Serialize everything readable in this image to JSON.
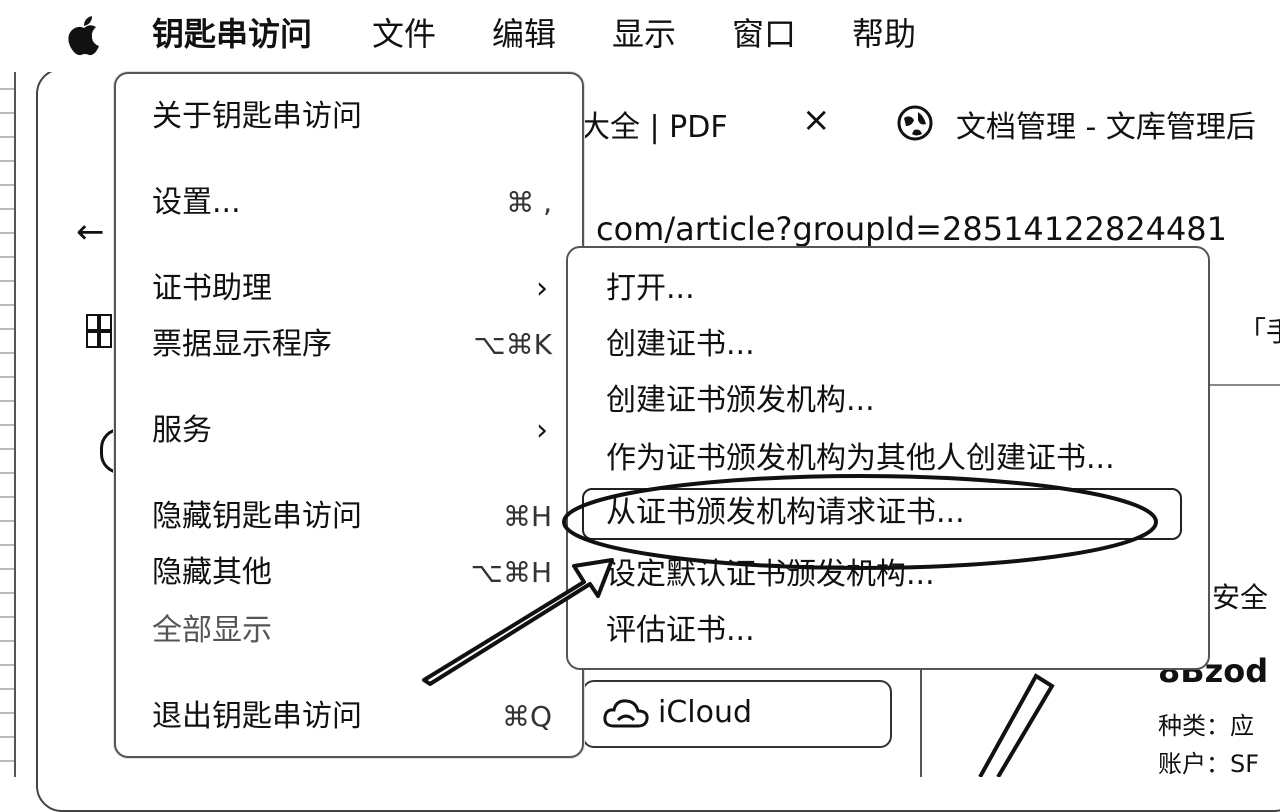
{
  "menubar": {
    "items": [
      "钥匙串访问",
      "文件",
      "编辑",
      "显示",
      "窗口",
      "帮助"
    ]
  },
  "browser": {
    "tab1_fragment": "大全 | PDF",
    "tab_close": "×",
    "tab2_title": "文档管理 - 文库管理后",
    "url_fragment": "com/article?groupId=28514122824481",
    "back_glyph": "←",
    "bracket_fragment": "「手",
    "security_fragment": "安全",
    "name_fragment": "8Bzod",
    "kind_label": "种类：应",
    "account_label": "账户：SF"
  },
  "app_menu": {
    "items": [
      {
        "label": "关于钥匙串访问",
        "shortcut": "",
        "submenu": false,
        "enabled": true
      },
      {
        "label": "设置...",
        "shortcut": "⌘ ,",
        "submenu": false,
        "enabled": true
      },
      {
        "label": "证书助理",
        "shortcut": "",
        "submenu": true,
        "enabled": true
      },
      {
        "label": "票据显示程序",
        "shortcut": "⌥⌘K",
        "submenu": false,
        "enabled": true
      },
      {
        "label": "服务",
        "shortcut": "",
        "submenu": true,
        "enabled": true
      },
      {
        "label": "隐藏钥匙串访问",
        "shortcut": "⌘H",
        "submenu": false,
        "enabled": true
      },
      {
        "label": "隐藏其他",
        "shortcut": "⌥⌘H",
        "submenu": false,
        "enabled": true
      },
      {
        "label": "全部显示",
        "shortcut": "",
        "submenu": false,
        "enabled": false
      },
      {
        "label": "退出钥匙串访问",
        "shortcut": "⌘Q",
        "submenu": false,
        "enabled": true
      }
    ],
    "chevron": "›"
  },
  "cert_submenu": {
    "items": [
      "打开...",
      "创建证书...",
      "创建证书颁发机构...",
      "作为证书颁发机构为其他人创建证书...",
      "从证书颁发机构请求证书...",
      "设定默认证书颁发机构...",
      "评估证书..."
    ],
    "highlighted_index": 4
  },
  "sidebar": {
    "icloud_label": "iCloud"
  }
}
